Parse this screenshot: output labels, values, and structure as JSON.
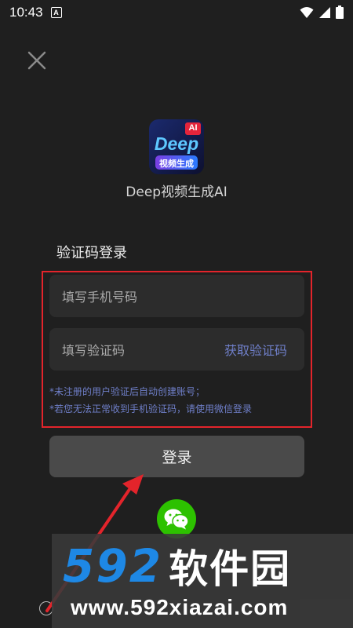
{
  "status_bar": {
    "time": "10:43",
    "notification_letter": "A"
  },
  "app": {
    "logo_text": "Deep",
    "logo_badge": "AI",
    "logo_subtitle": "视频生成",
    "name": "Deep视频生成AI"
  },
  "login": {
    "section_title": "验证码登录",
    "phone_placeholder": "填写手机号码",
    "code_placeholder": "填写验证码",
    "get_code_label": "获取验证码",
    "notice_1": "*未注册的用户验证后自动创建账号；",
    "notice_2": "*若您无法正常收到手机验证码，请使用微信登录",
    "login_button": "登录"
  },
  "watermark": {
    "digits": "592",
    "site_name": "软件园",
    "url": "www.592xiazai.com"
  },
  "icons": {
    "close": "close-icon",
    "wechat": "wechat-icon",
    "wifi": "wifi-icon",
    "signal": "signal-icon",
    "battery": "battery-icon"
  },
  "colors": {
    "background": "#1f1f1f",
    "input_background": "#2c2c2c",
    "accent_link": "#6f7fc9",
    "annotation_red": "#e3242b",
    "wechat_green": "#2dc100",
    "watermark_blue": "#1e88e5"
  }
}
